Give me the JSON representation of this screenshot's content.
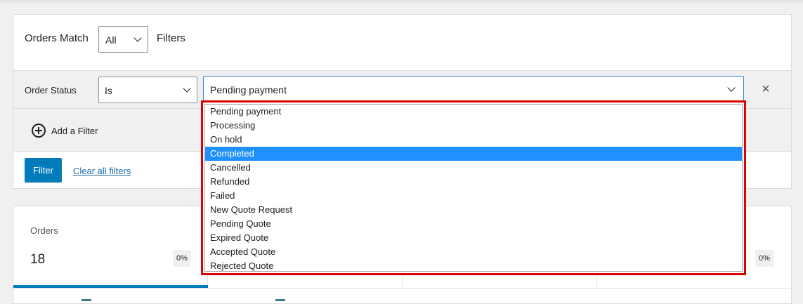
{
  "filters": {
    "match_label": "Orders Match",
    "match_value": "All",
    "filters_label": "Filters",
    "status_label": "Order Status",
    "operator_value": "Is",
    "status_value": "Pending payment",
    "add_filter_label": "Add a Filter",
    "filter_button": "Filter",
    "clear_link": "Clear all filters"
  },
  "dropdown": {
    "selected_index": 3,
    "options": [
      "Pending payment",
      "Processing",
      "On hold",
      "Completed",
      "Cancelled",
      "Refunded",
      "Failed",
      "New Quote Request",
      "Pending Quote",
      "Expired Quote",
      "Accepted Quote",
      "Rejected Quote"
    ],
    "highlight_color": "#1e90ff",
    "outline_color": "#e00000"
  },
  "stats": {
    "orders_label": "Orders",
    "orders_value": "18",
    "orders_change": "0%",
    "right_change": "0%"
  },
  "colors": {
    "primary": "#007cba",
    "link": "#2271b1"
  }
}
